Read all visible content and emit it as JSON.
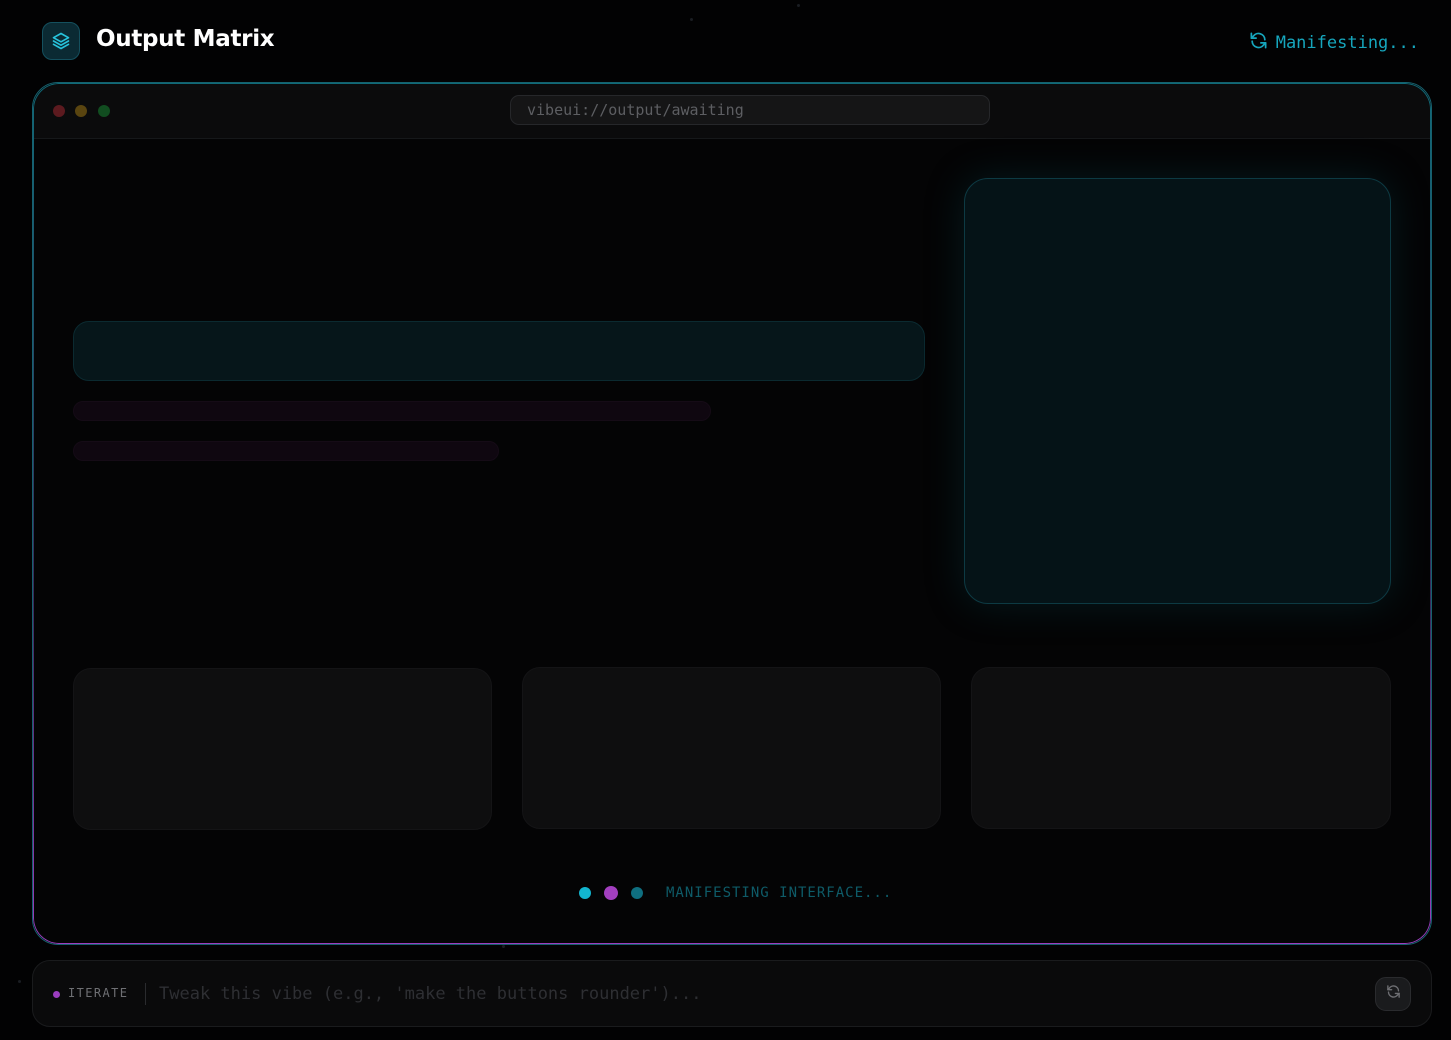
{
  "header": {
    "title": "Output Matrix",
    "status_text": "Manifesting..."
  },
  "browser": {
    "url": "vibeui://output/awaiting",
    "window_dots": [
      {
        "color": "#5c1a1f"
      },
      {
        "color": "#5a4510"
      },
      {
        "color": "#114d20"
      }
    ]
  },
  "loading": {
    "text": "MANIFESTING INTERFACE...",
    "dot_colors": [
      "#12b5cf",
      "#a23fbf",
      "#0f6f80"
    ]
  },
  "iterate": {
    "label": "ITERATE",
    "placeholder": "Tweak this vibe (e.g., 'make the buttons rounder')...",
    "value": ""
  },
  "colors": {
    "accent_cyan": "#16a6bd",
    "accent_magenta": "#9b3dbf",
    "background": "#020203"
  }
}
